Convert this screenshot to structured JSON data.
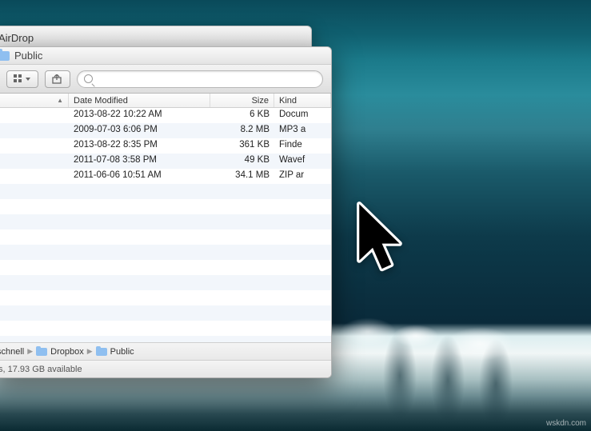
{
  "back_window": {
    "title": "AirDrop"
  },
  "window": {
    "title": "Public",
    "toolbar": {
      "search_placeholder": ""
    },
    "columns": {
      "name": "",
      "date": "Date Modified",
      "size": "Size",
      "kind": "Kind"
    },
    "rows": [
      {
        "date": "2013-08-22 10:22 AM",
        "size": "6 KB",
        "kind": "Docum"
      },
      {
        "date": "2009-07-03 6:06 PM",
        "size": "8.2 MB",
        "kind": "MP3 a"
      },
      {
        "date": "2013-08-22 8:35 PM",
        "size": "361 KB",
        "kind": "Finde"
      },
      {
        "date": "2011-07-08 3:58 PM",
        "size": "49 KB",
        "kind": "Wavef"
      },
      {
        "date": "2011-06-06 10:51 AM",
        "size": "34.1 MB",
        "kind": "ZIP ar"
      }
    ],
    "path": [
      {
        "label": "schnell",
        "icon": "folder"
      },
      {
        "label": "Dropbox",
        "icon": "folder"
      },
      {
        "label": "Public",
        "icon": "folder"
      }
    ],
    "status": "s, 17.93 GB available"
  },
  "watermark": "wskdn.com"
}
